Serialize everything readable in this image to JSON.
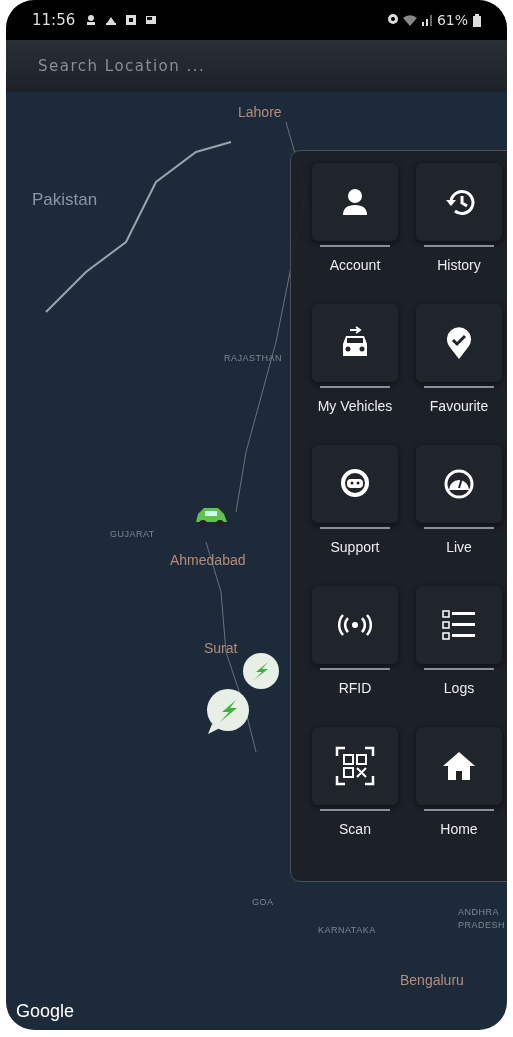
{
  "status_bar": {
    "time": "11:56",
    "battery": "61%"
  },
  "search": {
    "placeholder": "Search Location ..."
  },
  "map": {
    "labels": [
      {
        "text": "Lahore",
        "kind": "city"
      },
      {
        "text": "Pakistan",
        "kind": "country"
      },
      {
        "text": "RAJASTHAN",
        "kind": "region"
      },
      {
        "text": "GUJARAT",
        "kind": "region"
      },
      {
        "text": "Ahmedabad",
        "kind": "city"
      },
      {
        "text": "Surat",
        "kind": "city"
      },
      {
        "text": "GOA",
        "kind": "region"
      },
      {
        "text": "KARNATAKA",
        "kind": "region"
      },
      {
        "text": "ANDHRA PRADESH",
        "kind": "region"
      },
      {
        "text": "Bengaluru",
        "kind": "city"
      }
    ],
    "attribution": "Google"
  },
  "menu": {
    "items": [
      {
        "label": "Account"
      },
      {
        "label": "History"
      },
      {
        "label": "My Vehicles"
      },
      {
        "label": "Favourite"
      },
      {
        "label": "Support"
      },
      {
        "label": "Live"
      },
      {
        "label": "RFID"
      },
      {
        "label": "Logs"
      },
      {
        "label": "Scan"
      },
      {
        "label": "Home"
      }
    ]
  }
}
